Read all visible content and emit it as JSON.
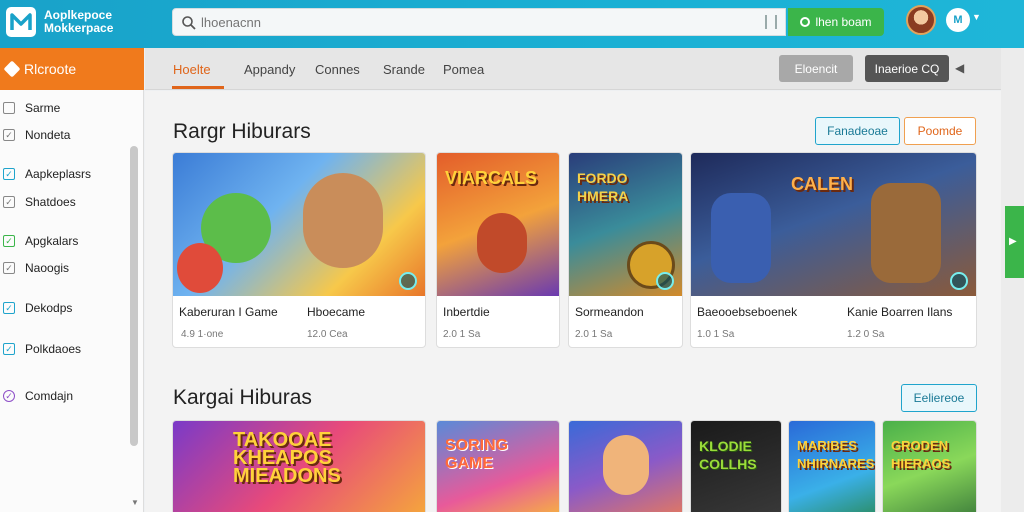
{
  "header": {
    "brand_line1": "Aoplkepoce",
    "brand_line2": "Mokkerpace",
    "search_placeholder": "lhoenacnn",
    "signup_label": "lhen boam",
    "user_initials": "M"
  },
  "sidebar": {
    "title": "Rlcroote",
    "items": [
      {
        "label": "Sarme",
        "check": ""
      },
      {
        "label": "Nondeta",
        "check": "✓"
      },
      {
        "label": "Aapkeplasrs",
        "check": "✓"
      },
      {
        "label": "Shatdoes",
        "check": "✓"
      },
      {
        "label": "Apgkalars",
        "check": "✓"
      },
      {
        "label": "Naoogis",
        "check": "✓"
      },
      {
        "label": "Dekodps",
        "check": "✓"
      },
      {
        "label": "Polkdaoes",
        "check": "✓"
      },
      {
        "label": "Comdajn",
        "check": "✓"
      }
    ]
  },
  "tabs": {
    "items": [
      "Hoelte",
      "Appandy",
      "Connes",
      "Srande",
      "Pomea"
    ],
    "btn_gray": "Eloencit",
    "btn_dark": "Inaerioe CQ"
  },
  "section1": {
    "title": "Rargr Hiburars",
    "btn_teal": "Fanadeoae",
    "btn_orange": "Poomde",
    "cards": [
      {
        "title": "Kaberuran I Game",
        "meta": "4.9  1·one",
        "thumb_text": "",
        "sub_title": "Hboecame",
        "sub_meta": "12.0  Cea"
      },
      {
        "title": "Inbertdie",
        "meta": "2.0  1  Sa",
        "thumb_text": "VIARCALS"
      },
      {
        "title": "Sormeandon",
        "meta": "2.0  1  Sa",
        "thumb_text": "FORDO HMERA"
      },
      {
        "title": "Baeooebseboenek",
        "meta": "1.0  1  Sa",
        "thumb_text": "CALEN",
        "sub_title": "Kanie Boarren Ilans",
        "sub_meta": "1.2  0  Sa"
      }
    ]
  },
  "section2": {
    "title": "Kargai Hiburas",
    "btn_teal": "Eeliereoe",
    "thumbs": [
      "TAKOOAE KHEAPOS MIEADONS",
      "SORING GAME",
      "",
      "KLODIE COLLHS",
      "MARIBES NHIRNARES",
      "GRODEN HIERAOS"
    ]
  },
  "colors": {
    "topbar": "#19a2c9",
    "accent_orange": "#f07a1c",
    "accent_green": "#3bb54a"
  }
}
